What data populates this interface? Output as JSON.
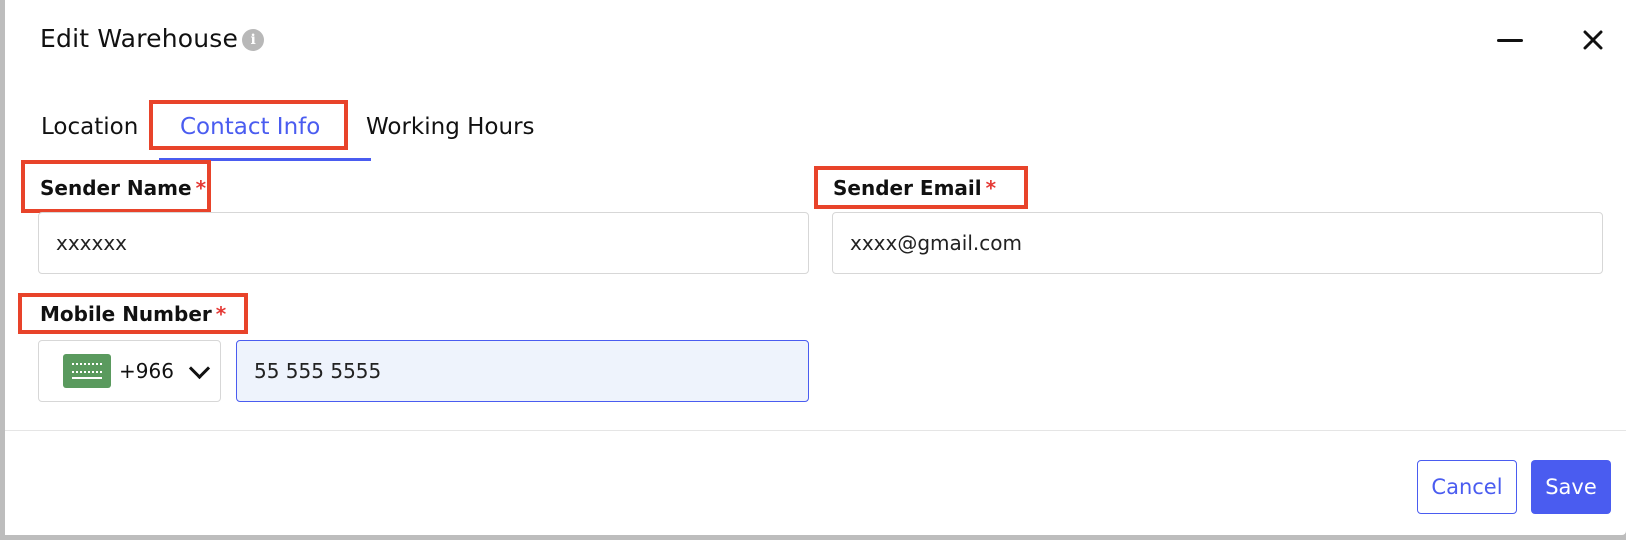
{
  "dialog": {
    "title": "Edit Warehouse",
    "info_icon_glyph": "i"
  },
  "window_controls": {
    "minimize_icon": "minimize-icon",
    "close_icon": "close-icon",
    "close_glyph": "✕"
  },
  "tabs": [
    {
      "label": "Location",
      "active": false
    },
    {
      "label": "Contact Info",
      "active": true
    },
    {
      "label": "Working Hours",
      "active": false
    }
  ],
  "form": {
    "sender_name": {
      "label": "Sender Name",
      "required_mark": "*",
      "value": "xxxxxx"
    },
    "sender_email": {
      "label": "Sender Email",
      "required_mark": "*",
      "value": "xxxx@gmail.com"
    },
    "mobile_number": {
      "label": "Mobile Number",
      "required_mark": "*",
      "country_flag": "saudi-arabia-flag-icon",
      "dial_code": "+966",
      "value": "55 555 5555"
    }
  },
  "footer": {
    "cancel_label": "Cancel",
    "save_label": "Save"
  },
  "colors": {
    "accent": "#4a5cf0",
    "highlight": "#e8432a",
    "required": "#e53935",
    "focused_input_bg": "#eef3fc"
  }
}
